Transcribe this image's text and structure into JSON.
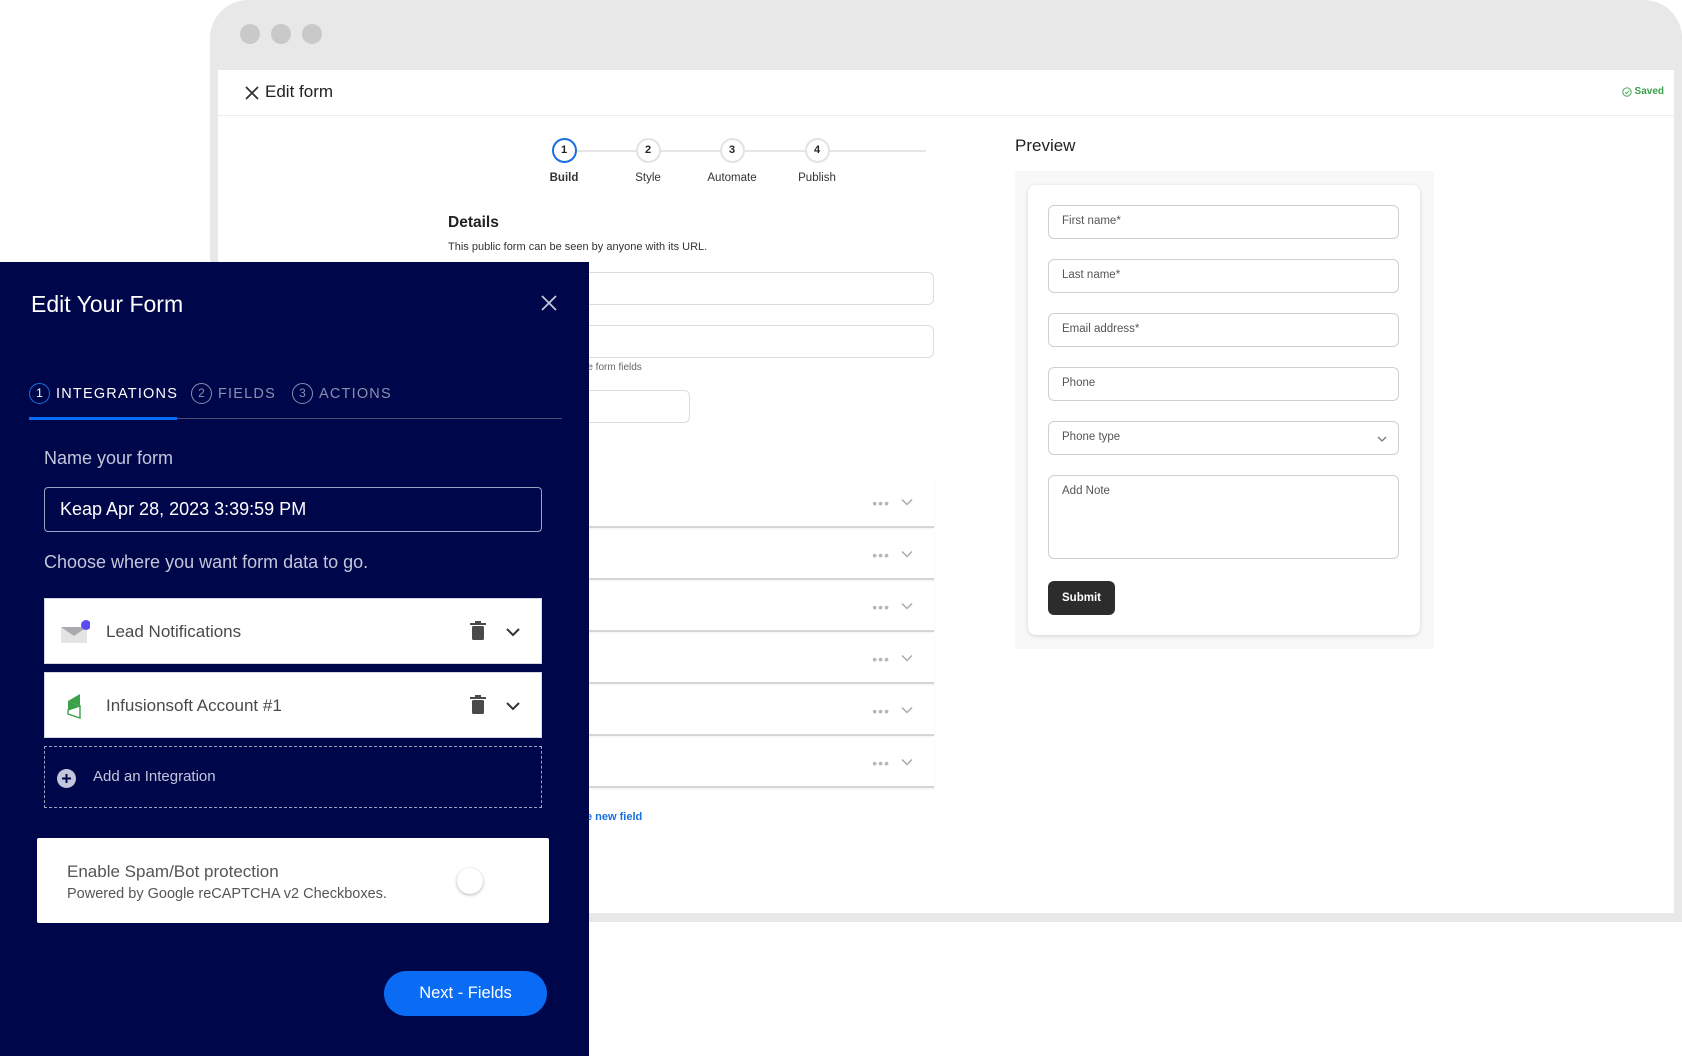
{
  "window": {
    "header": {
      "close_icon": "close-icon",
      "title": "Edit form",
      "saved_label": "Saved",
      "saved_icon": "check-circle-icon"
    },
    "steps": [
      {
        "num": "1",
        "label": "Build",
        "active": true
      },
      {
        "num": "2",
        "label": "Style",
        "active": false
      },
      {
        "num": "3",
        "label": "Automate",
        "active": false
      },
      {
        "num": "4",
        "label": "Publish",
        "active": false
      }
    ],
    "details": {
      "title": "Details",
      "subtitle": "This public form can be seen by anyone with its URL.",
      "helper_text_partial": "the form fields"
    },
    "field_rows": [
      {
        "more_icon": "ellipsis-icon",
        "expand_icon": "chevron-down-icon"
      },
      {
        "more_icon": "ellipsis-icon",
        "expand_icon": "chevron-down-icon"
      },
      {
        "more_icon": "ellipsis-icon",
        "expand_icon": "chevron-down-icon"
      },
      {
        "more_icon": "ellipsis-icon",
        "expand_icon": "chevron-down-icon"
      },
      {
        "more_icon": "ellipsis-icon",
        "expand_icon": "chevron-down-icon"
      },
      {
        "more_icon": "ellipsis-icon",
        "expand_icon": "chevron-down-icon"
      }
    ],
    "new_field_link_partial": "e new field",
    "preview": {
      "title": "Preview",
      "fields": [
        {
          "placeholder": "First name*"
        },
        {
          "placeholder": "Last name*"
        },
        {
          "placeholder": "Email address*"
        },
        {
          "placeholder": "Phone"
        }
      ],
      "phone_type_select": "Phone type",
      "note_placeholder": "Add Note",
      "submit_label": "Submit"
    }
  },
  "panel": {
    "title": "Edit Your Form",
    "close_icon": "close-icon",
    "tabs": [
      {
        "num": "1",
        "label": "INTEGRATIONS",
        "active": true
      },
      {
        "num": "2",
        "label": "FIELDS",
        "active": false
      },
      {
        "num": "3",
        "label": "ACTIONS",
        "active": false
      }
    ],
    "name_label": "Name your form",
    "name_value": "Keap Apr 28, 2023 3:39:59 PM",
    "choose_label": "Choose where you want form data to go.",
    "integrations": [
      {
        "name": "Lead Notifications",
        "icon": "envelope-icon"
      },
      {
        "name": "Infusionsoft Account #1",
        "icon": "infusionsoft-logo-icon"
      }
    ],
    "add_integration_label": "Add an Integration",
    "spam": {
      "title": "Enable Spam/Bot protection",
      "subtitle": "Powered by Google reCAPTCHA v2 Checkboxes.",
      "enabled": false
    },
    "next_button": "Next - Fields"
  },
  "colors": {
    "panel_bg": "#00064a",
    "accent_blue": "#0a6cf5",
    "saved_green": "#3aa14a",
    "submit_dark": "#2c2c2c"
  }
}
